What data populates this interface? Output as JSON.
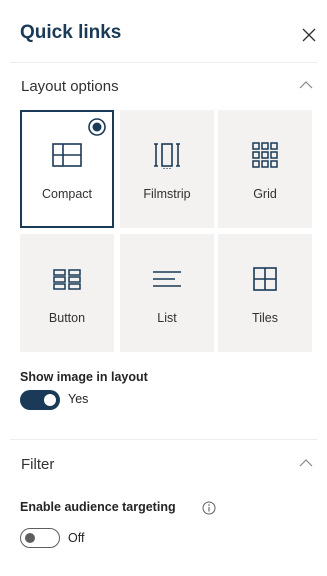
{
  "panel": {
    "title": "Quick links"
  },
  "layout_section": {
    "title": "Layout options",
    "tiles": [
      {
        "label": "Compact",
        "icon": "compact-layout-icon",
        "selected": true
      },
      {
        "label": "Filmstrip",
        "icon": "filmstrip-layout-icon",
        "selected": false
      },
      {
        "label": "Grid",
        "icon": "grid-layout-icon",
        "selected": false
      },
      {
        "label": "Button",
        "icon": "button-layout-icon",
        "selected": false
      },
      {
        "label": "List",
        "icon": "list-layout-icon",
        "selected": false
      },
      {
        "label": "Tiles",
        "icon": "tiles-layout-icon",
        "selected": false
      }
    ],
    "show_image_label": "Show image in layout",
    "show_image_state": "Yes",
    "show_image_on": true
  },
  "filter_section": {
    "title": "Filter",
    "audience_label": "Enable audience targeting",
    "audience_state": "Off",
    "audience_on": false
  },
  "colors": {
    "accent": "#1b3a57",
    "tile_bg": "#f3f2f1",
    "text": "#323130"
  }
}
